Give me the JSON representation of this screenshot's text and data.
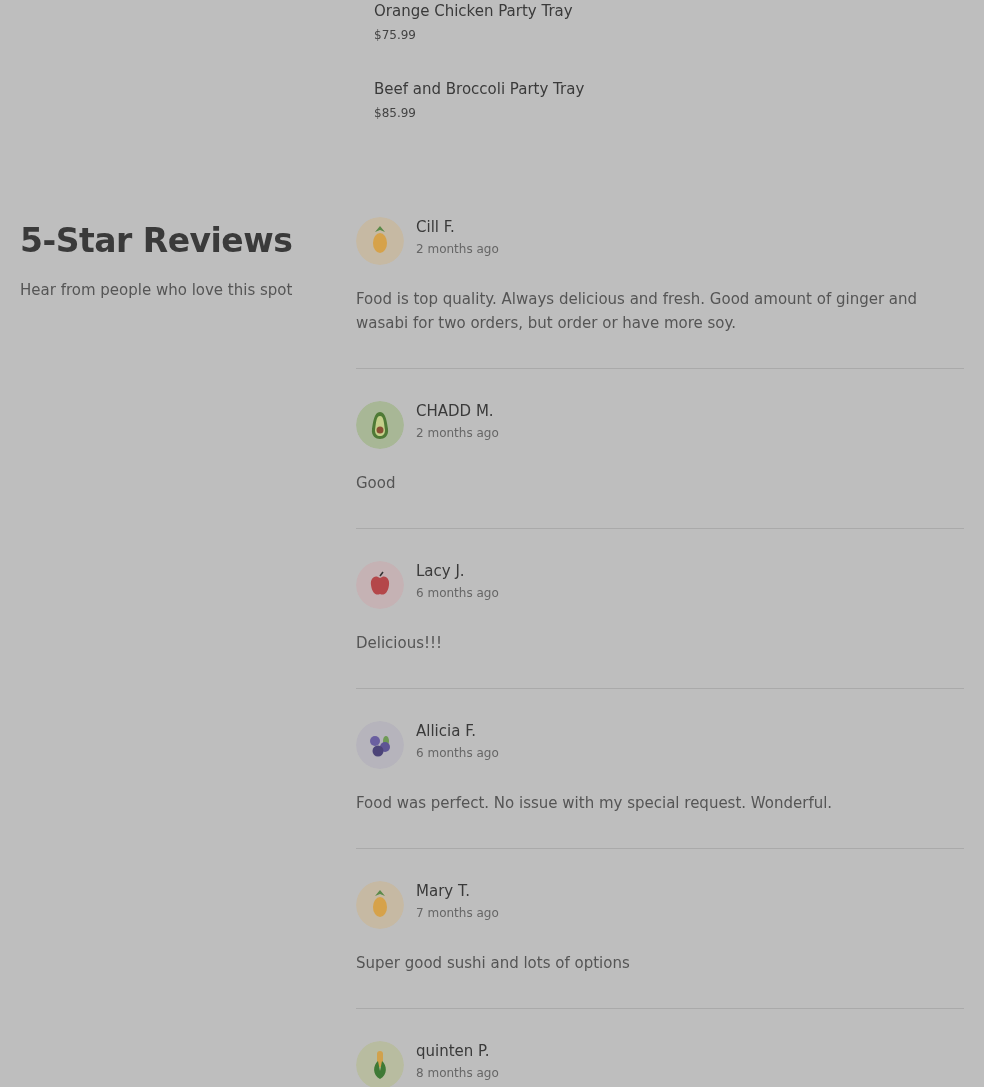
{
  "menu_items": [
    {
      "name": "Orange Chicken Party Tray",
      "price": "$75.99"
    },
    {
      "name": "Beef and Broccoli Party Tray",
      "price": "$85.99"
    }
  ],
  "reviews_section": {
    "title": "5-Star Reviews",
    "subtitle": "Hear from people who love this spot"
  },
  "reviews": [
    {
      "avatar": {
        "kind": "pineapple"
      },
      "name": "Cill F.",
      "date": "2 months ago",
      "text": "Food is top quality. Always delicious and fresh. Good amount of ginger and wasabi for two orders, but order or have more soy."
    },
    {
      "avatar": {
        "kind": "avocado"
      },
      "name": "CHADD M.",
      "date": "2 months ago",
      "text": "Good"
    },
    {
      "avatar": {
        "kind": "apple"
      },
      "name": "Lacy J.",
      "date": "6 months ago",
      "text": "Delicious!!!"
    },
    {
      "avatar": {
        "kind": "blueberry"
      },
      "name": "Allicia F.",
      "date": "6 months ago",
      "text": "Food was perfect. No issue with my special request. Wonderful."
    },
    {
      "avatar": {
        "kind": "pineapple"
      },
      "name": "Mary T.",
      "date": "7 months ago",
      "text": "Super good sushi and lots of options"
    },
    {
      "avatar": {
        "kind": "corn"
      },
      "name": "quinten P.",
      "date": "8 months ago"
    }
  ]
}
